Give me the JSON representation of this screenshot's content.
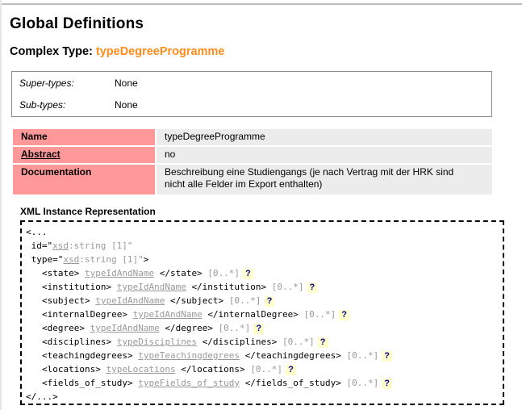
{
  "page": {
    "title": "Global Definitions"
  },
  "complex_type": {
    "prefix": "Complex Type:",
    "name": "typeDegreeProgramme"
  },
  "hierarchy": {
    "supertypes_label": "Super-types:",
    "supertypes_value": "None",
    "subtypes_label": "Sub-types:",
    "subtypes_value": "None"
  },
  "properties": {
    "name_label": "Name",
    "name_value": "typeDegreeProgramme",
    "abstract_label": "Abstract",
    "abstract_value": "no",
    "documentation_label": "Documentation",
    "documentation_line1": "Beschreibung eine Studiengangs (je nach Vertrag mit der HRK sind",
    "documentation_line2": "nicht alle Felder im Export enthalten)"
  },
  "xml": {
    "heading": "XML Instance Representation",
    "open": "<...",
    "attributes": [
      {
        "pre": " id=\"",
        "type": "xsd",
        "rest": ":string [1]\"",
        "close": ""
      },
      {
        "pre": " type=\"",
        "type": "xsd",
        "rest": ":string [1]\"",
        "close": ">"
      }
    ],
    "elements": [
      {
        "open": "<state>",
        "type": "typeIdAndName",
        "close": "</state>",
        "card": "[0..*]",
        "help": "?"
      },
      {
        "open": "<institution>",
        "type": "typeIdAndName",
        "close": "</institution>",
        "card": "[0..*]",
        "help": "?"
      },
      {
        "open": "<subject>",
        "type": "typeIdAndName",
        "close": "</subject>",
        "card": "[0..*]",
        "help": "?"
      },
      {
        "open": "<internalDegree>",
        "type": "typeIdAndName",
        "close": "</internalDegree>",
        "card": "[0..*]",
        "help": "?"
      },
      {
        "open": "<degree>",
        "type": "typeIdAndName",
        "close": "</degree>",
        "card": "[0..*]",
        "help": "?"
      },
      {
        "open": "<disciplines>",
        "type": "typeDisciplines",
        "close": "</disciplines>",
        "card": "[0..*]",
        "help": "?"
      },
      {
        "open": "<teachingdegrees>",
        "type": "typeTeachingdegrees",
        "close": "</teachingdegrees>",
        "card": "[0..*]",
        "help": "?"
      },
      {
        "open": "<locations>",
        "type": "typeLocations",
        "close": "</locations>",
        "card": "[0..*]",
        "help": "?"
      },
      {
        "open": "<fields_of_study>",
        "type": "typeFields_of_study",
        "close": "</fields_of_study>",
        "card": "[0..*]",
        "help": "?"
      }
    ],
    "close": "</...>"
  }
}
